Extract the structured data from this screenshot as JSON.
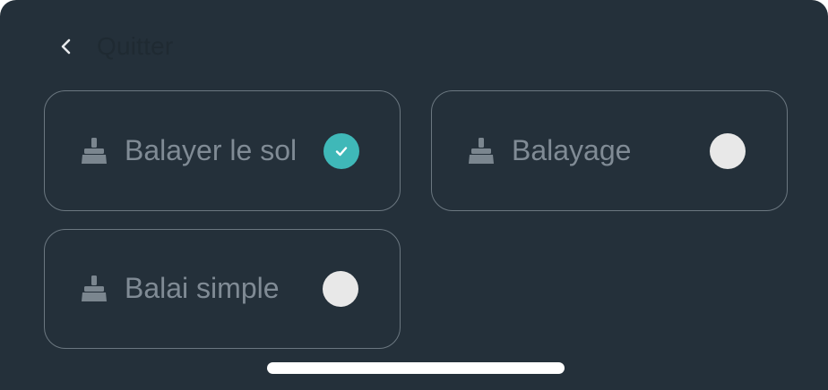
{
  "header": {
    "back_label": "Quitter",
    "back_icon": "chevron-left-icon"
  },
  "options": [
    {
      "label": "Balayer le sol",
      "icon": "broom-icon",
      "selected": true
    },
    {
      "label": "Balayage",
      "icon": "broom-icon",
      "selected": false
    },
    {
      "label": "Balai simple",
      "icon": "broom-icon",
      "selected": false
    }
  ],
  "colors": {
    "background": "#24303a",
    "card_border": "#6b7780",
    "label_text": "#808b95",
    "icon": "#7b868f",
    "accent_selected": "#3fb8b8",
    "radio_unselected": "#e8e8e8",
    "home_indicator": "#ffffff"
  }
}
